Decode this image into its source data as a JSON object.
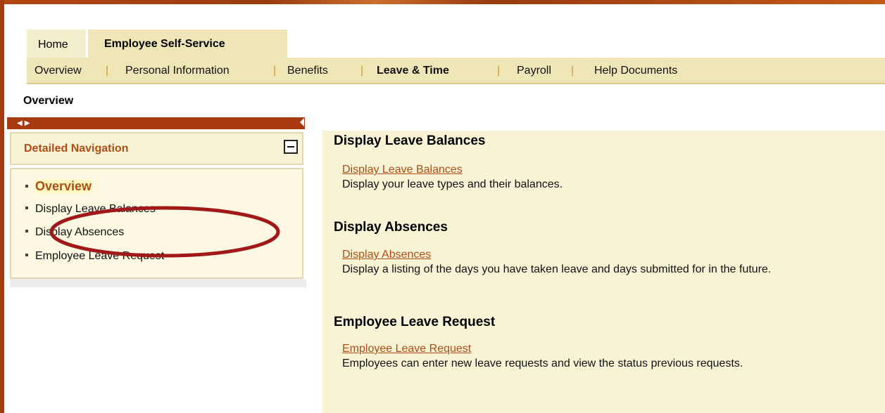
{
  "tabs": {
    "home": "Home",
    "ess": "Employee Self-Service"
  },
  "subnav": {
    "items": [
      "Overview",
      "Personal Information",
      "Benefits",
      "Leave & Time",
      "Payroll",
      "Help Documents"
    ],
    "separator": "|",
    "active": "Leave & Time"
  },
  "page": {
    "title": "Overview"
  },
  "nav": {
    "header": "Detailed Navigation",
    "items": [
      "Overview",
      "Display Leave Balances",
      "Display Absences",
      "Employee Leave Request"
    ],
    "active": "Overview"
  },
  "content": {
    "sections": [
      {
        "title": "Display Leave Balances",
        "link": "Display Leave Balances",
        "desc": "Display your leave types and their balances."
      },
      {
        "title": "Display Absences",
        "link": "Display Absences",
        "desc": "Display a listing of the days you have taken leave and days submitted for in the future."
      },
      {
        "title": "Employee Leave Request",
        "link": "Employee Leave Request",
        "desc": "Employees can enter new leave requests and view the status previous requests."
      }
    ]
  },
  "colors": {
    "frame": "#a33a10",
    "tab_bg": "#efe6b8",
    "link": "#b04d15",
    "annotation": "#a01818"
  },
  "icons": {
    "collapse": "minus-box-icon",
    "arrows": "left-right-arrows-icon"
  }
}
